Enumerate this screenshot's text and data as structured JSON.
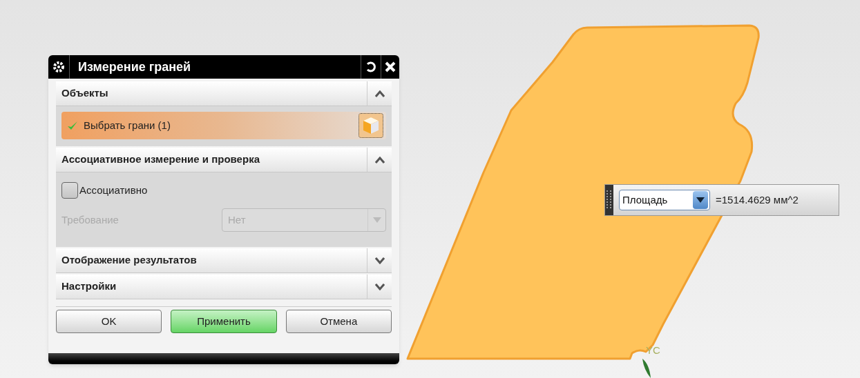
{
  "dialog": {
    "title": "Измерение граней",
    "sections": [
      {
        "kind": "selection",
        "title": "Объекты",
        "expanded": true,
        "selection_label": "Выбрать грани (1)",
        "done": true
      },
      {
        "kind": "associative",
        "title": "Ассоциативное измерение и проверка",
        "expanded": true,
        "checkbox": {
          "label": "Ассоциативно",
          "checked": false
        },
        "requirement": {
          "label": "Требование",
          "value": "Нет",
          "disabled": true
        }
      },
      {
        "kind": "collapsed",
        "title": "Отображение результатов",
        "expanded": false
      },
      {
        "kind": "collapsed",
        "title": "Настройки",
        "expanded": false
      }
    ],
    "buttons": [
      {
        "label": "OK",
        "primary": false
      },
      {
        "label": "Применить",
        "primary": true
      },
      {
        "label": "Отмена",
        "primary": false
      }
    ]
  },
  "measure_bar": {
    "type": "Площадь",
    "value": "=1514.4629 мм^2"
  },
  "axis_label": "YC"
}
